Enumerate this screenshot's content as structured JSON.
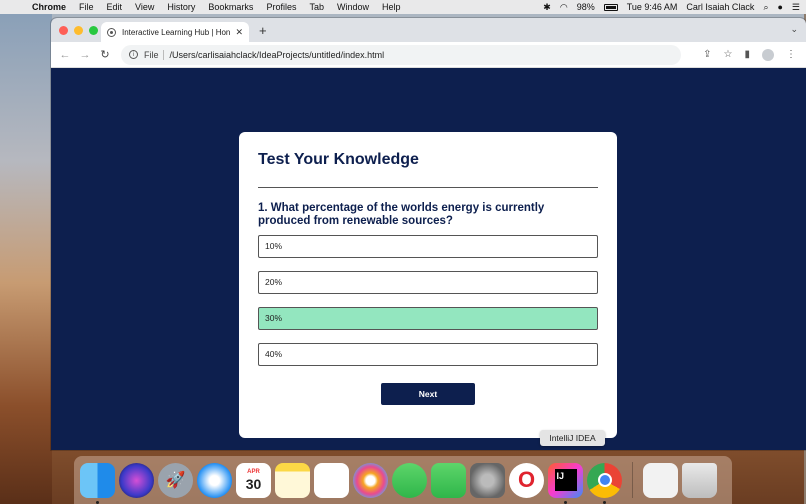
{
  "menubar": {
    "app_name": "Chrome",
    "items": [
      "File",
      "Edit",
      "View",
      "History",
      "Bookmarks",
      "Profiles",
      "Tab",
      "Window",
      "Help"
    ],
    "battery": "98%",
    "clock": "Tue 9:46 AM",
    "user": "Carl Isaiah Clack"
  },
  "browser": {
    "tab_title": "Interactive Learning Hub | Hon",
    "file_label": "File",
    "url": "/Users/carlisaiahclack/IdeaProjects/untitled/index.html"
  },
  "quiz": {
    "title": "Test Your Knowledge",
    "question": "1. What percentage of the worlds energy is currently produced from renewable sources?",
    "options": [
      {
        "label": "10%",
        "selected": false
      },
      {
        "label": "20%",
        "selected": false
      },
      {
        "label": "30%",
        "selected": true
      },
      {
        "label": "40%",
        "selected": false
      }
    ],
    "next_label": "Next"
  },
  "dock": {
    "tooltip": "IntelliJ IDEA",
    "calendar": {
      "month": "APR",
      "day": "30"
    },
    "apps": [
      "Finder",
      "Siri",
      "Launchpad",
      "Safari",
      "Calendar",
      "Notes",
      "Reminders",
      "Photos",
      "Messages",
      "FaceTime",
      "System Preferences",
      "Opera",
      "IntelliJ IDEA",
      "Google Chrome",
      "Document",
      "Trash"
    ]
  },
  "colors": {
    "page_background": "#0d1f4e",
    "selected_option": "#93e6bf",
    "button": "#0d1f4e"
  }
}
